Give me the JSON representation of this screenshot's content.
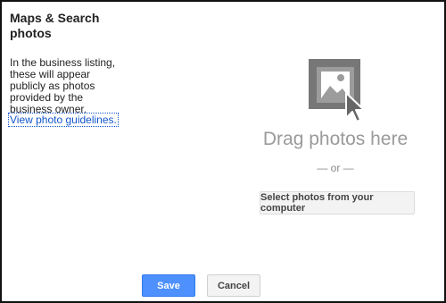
{
  "sidebar": {
    "title": "Maps & Search photos",
    "description": "In the business listing, these will appear publicly as photos provided by the business owner.",
    "guidelines_link": "View photo guidelines."
  },
  "dropzone": {
    "icon": "photo-upload-icon",
    "drag_text": "Drag photos here",
    "or_text": "— or —",
    "select_button": "Select photos from your computer"
  },
  "footer": {
    "save_label": "Save",
    "cancel_label": "Cancel"
  },
  "colors": {
    "link": "#1155cc",
    "primary_button": "#4d90fe",
    "muted_text": "#9a9a9a"
  }
}
